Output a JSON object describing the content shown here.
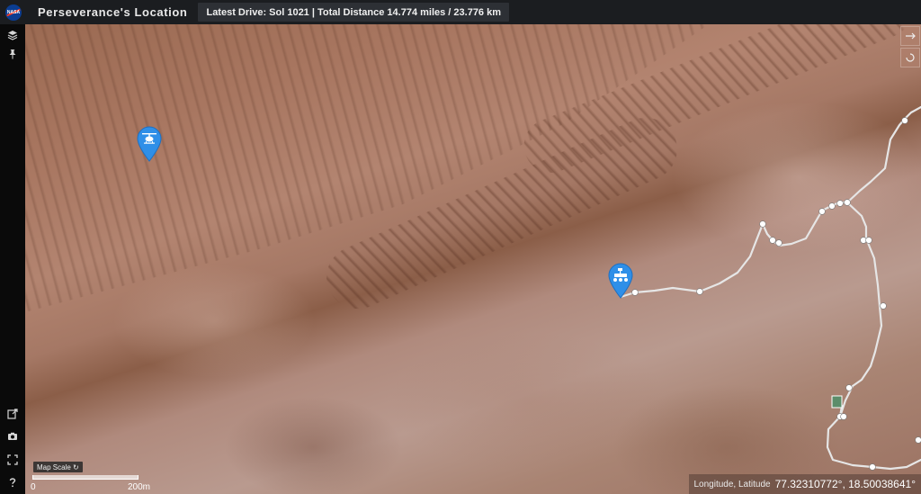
{
  "header": {
    "logo_text": "NASA",
    "title": "Perseverance's Location",
    "drive_info": "Latest Drive: Sol 1021 | Total Distance 14.774 miles / 23.776 km"
  },
  "rail": {
    "top_icons": [
      "layers-icon",
      "pin-icon"
    ],
    "bottom_icons": [
      "external-link-icon",
      "camera-icon",
      "fullscreen-icon",
      "help-icon"
    ]
  },
  "map": {
    "markers": [
      "helicopter-marker",
      "rover-marker"
    ],
    "scale": {
      "button_label": "Map Scale ↻",
      "start_label": "0",
      "end_label": "200m"
    },
    "coordinates": {
      "label": "Longitude, Latitude",
      "value": "77.32310772°, 18.50038641°"
    }
  },
  "colors": {
    "header_bg": "#1b1d20",
    "marker_blue": "#2f8fe8",
    "route": "#e6e6e6"
  }
}
